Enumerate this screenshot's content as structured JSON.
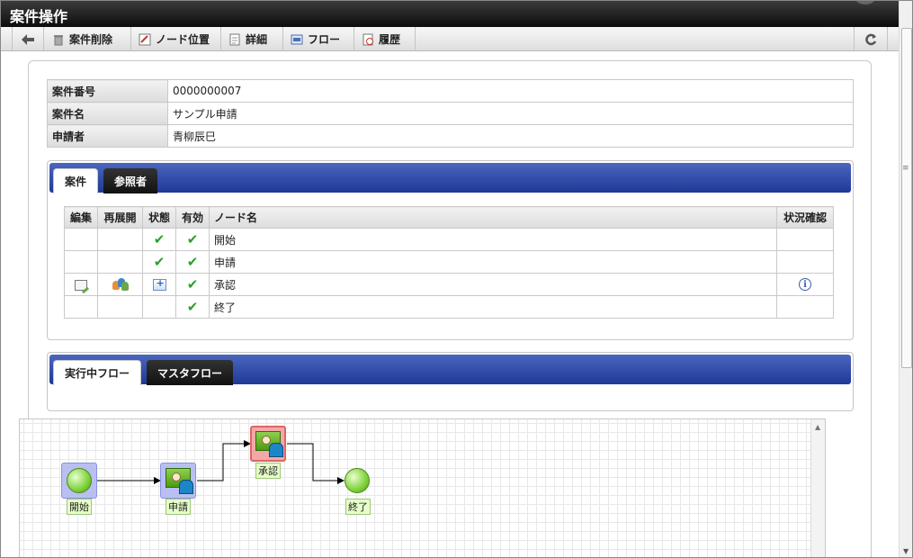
{
  "window": {
    "title": "案件操作"
  },
  "toolbar": {
    "delete_label": "案件削除",
    "node_position_label": "ノード位置",
    "detail_label": "詳細",
    "flow_label": "フロー",
    "history_label": "履歴"
  },
  "case_info": {
    "rows": [
      {
        "key": "案件番号",
        "value": "0000000007"
      },
      {
        "key": "案件名",
        "value": "サンプル申請"
      },
      {
        "key": "申請者",
        "value": "青柳辰巳"
      }
    ]
  },
  "case_tabs": {
    "tabs": [
      {
        "label": "案件",
        "active": true
      },
      {
        "label": "参照者",
        "active": false
      }
    ]
  },
  "node_table": {
    "headers": [
      "編集",
      "再展開",
      "状態",
      "有効",
      "ノード名",
      "状況確認"
    ],
    "rows": [
      {
        "edit": false,
        "redeploy": false,
        "state": true,
        "valid": true,
        "name": "開始",
        "status_check": false
      },
      {
        "edit": false,
        "redeploy": false,
        "state": true,
        "valid": true,
        "name": "申請",
        "status_check": false
      },
      {
        "edit": true,
        "redeploy": true,
        "state": "flow-icon",
        "valid": true,
        "name": "承認",
        "status_check": true
      },
      {
        "edit": false,
        "redeploy": false,
        "state": false,
        "valid": true,
        "name": "終了",
        "status_check": false
      }
    ]
  },
  "flow_tabs": {
    "tabs": [
      {
        "label": "実行中フロー",
        "active": true
      },
      {
        "label": "マスタフロー",
        "active": false
      }
    ]
  },
  "flow_diagram": {
    "nodes": [
      {
        "label": "開始",
        "kind": "start"
      },
      {
        "label": "申請",
        "kind": "user"
      },
      {
        "label": "承認",
        "kind": "user-current"
      },
      {
        "label": "終了",
        "kind": "end"
      }
    ]
  },
  "colors": {
    "tab_bar": "#2a46a6",
    "current_node": "#f3a8a8",
    "node": "#b9bff0",
    "node_label_bg": "#e6ffc8",
    "check": "#2aa02a"
  }
}
